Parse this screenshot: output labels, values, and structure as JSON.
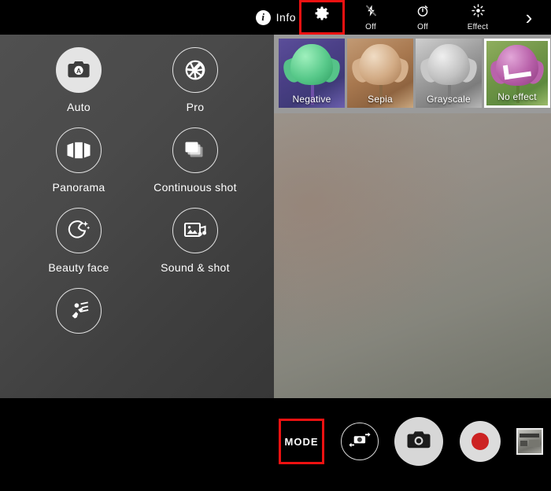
{
  "topbar": {
    "info": {
      "label": "Info",
      "icon": "info-icon"
    },
    "settings": {
      "icon": "gear-icon",
      "highlighted": true,
      "highlight_color": "#ee1111"
    },
    "flash": {
      "icon": "flash-off-icon",
      "label": "Off"
    },
    "timer": {
      "icon": "timer-icon",
      "label": "Off"
    },
    "effect": {
      "icon": "effect-icon",
      "label": "Effect"
    },
    "expand": {
      "icon": "chevron-right-icon",
      "glyph": "›"
    }
  },
  "effects_strip": {
    "background_color": "#9a9a9a",
    "items": [
      {
        "label": "Negative",
        "selected": false
      },
      {
        "label": "Sepia",
        "selected": false
      },
      {
        "label": "Grayscale",
        "selected": false
      },
      {
        "label": "No effect",
        "selected": true
      }
    ]
  },
  "mode_panel": {
    "items": [
      {
        "label": "Auto",
        "icon": "camera-auto-icon",
        "active": true
      },
      {
        "label": "Pro",
        "icon": "aperture-icon",
        "active": false
      },
      {
        "label": "Panorama",
        "icon": "panorama-icon",
        "active": false
      },
      {
        "label": "Continuous shot",
        "icon": "burst-icon",
        "active": false
      },
      {
        "label": "Beauty face",
        "icon": "beauty-face-icon",
        "active": false
      },
      {
        "label": "Sound & shot",
        "icon": "sound-and-shot-icon",
        "active": false
      },
      {
        "label": "Sports",
        "icon": "sports-icon",
        "active": false
      }
    ]
  },
  "bottombar": {
    "mode_button": {
      "label": "MODE",
      "highlighted": true,
      "highlight_color": "#ee1111"
    },
    "switch_camera": {
      "icon": "switch-camera-icon"
    },
    "shutter": {
      "icon": "camera-icon"
    },
    "record": {
      "icon": "record-dot-icon",
      "color": "#cc2222"
    },
    "gallery": {
      "icon": "gallery-thumbnail-icon"
    }
  }
}
